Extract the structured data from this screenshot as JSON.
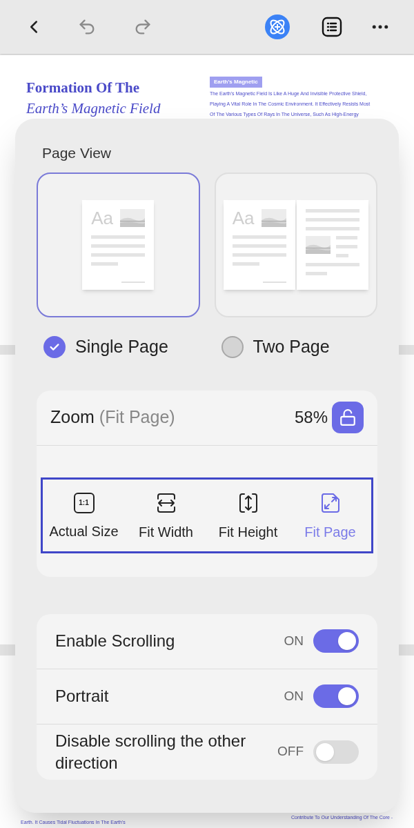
{
  "document": {
    "title_line1": "Formation Of The",
    "title_line2": "Earth’s Magnetic Field",
    "tag": "Earth's Magnetic",
    "body": [
      "The Earth's Magnetic Field Is Like A Huge And Invisible Protective Shield,",
      "Playing A Vital Role In The Cosmic Environment. It Effectively Resists Most",
      "Of The Various Types Of Rays In The Universe, Such As High-Energy"
    ],
    "footer_left": "Earth. It Causes Tidal Fluctuations In The Earth's",
    "footer_right": "Contribute To Our Understanding Of The Core -"
  },
  "panel": {
    "title": "Page View",
    "layouts": [
      {
        "kind": "single",
        "label": "Single Page",
        "sample_text": "Aa",
        "selected": true
      },
      {
        "kind": "two",
        "label": "Two Page",
        "sample_text": "Aa",
        "selected": false
      }
    ],
    "zoom": {
      "label": "Zoom",
      "mode": "(Fit Page)",
      "value": "58%",
      "locked": false
    },
    "zoom_options": [
      {
        "kind": "actual",
        "icon_text": "1:1",
        "label": "Actual Size",
        "selected": false
      },
      {
        "kind": "width",
        "label": "Fit Width",
        "selected": false
      },
      {
        "kind": "height",
        "label": "Fit Height",
        "selected": false
      },
      {
        "kind": "page",
        "label": "Fit Page",
        "selected": true
      }
    ],
    "settings": [
      {
        "label": "Enable Scrolling",
        "state_label": "ON",
        "on": true
      },
      {
        "label": "Portrait",
        "state_label": "ON",
        "on": true
      },
      {
        "label": "Disable scrolling the other direction",
        "state_label": "OFF",
        "on": false
      }
    ]
  }
}
